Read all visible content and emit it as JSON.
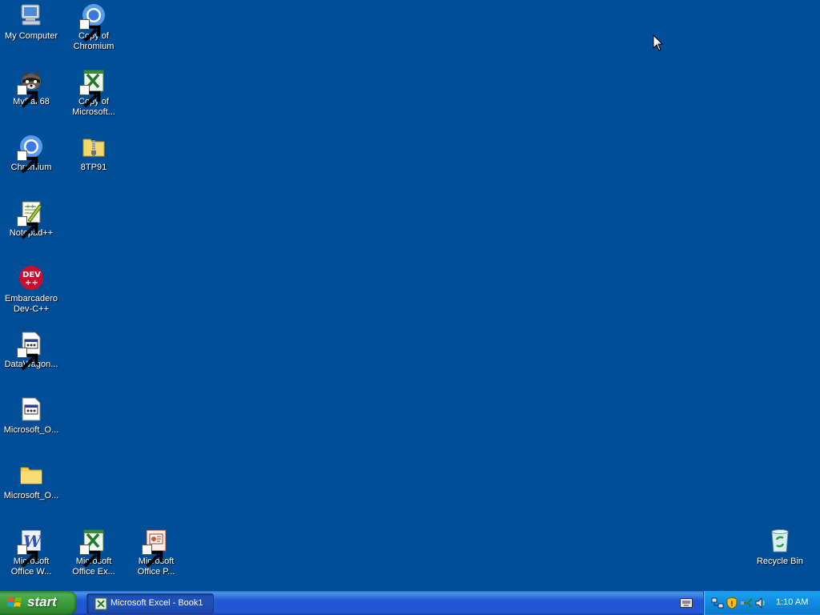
{
  "desktop": {
    "icons": {
      "my_computer": "My Computer",
      "copy_of_chromium": "Copy of Chromium",
      "mypal": "MyPal 68",
      "copy_of_excel": "Copy of Microsoft...",
      "chromium": "Chromium",
      "8tp91": "8TP91",
      "notepadpp": "Notepad++",
      "devcpp": "Embarcadero Dev-C++",
      "datawagon": "DataWagon...",
      "microsoft_o_file": "Microsoft_O...",
      "microsoft_o_folder": "Microsoft_O...",
      "office_word": "Microsoft Office W...",
      "office_excel": "Microsoft Office Ex...",
      "office_powerpoint": "Microsoft Office P...",
      "recycle_bin": "Recycle Bin"
    }
  },
  "taskbar": {
    "start_label": "start",
    "task_excel_label": "Microsoft Excel - Book1",
    "clock": "1:10 AM"
  },
  "colors": {
    "desktop_bg": "#004e98",
    "taskbar": "#2157d7",
    "start_green": "#379837",
    "tray": "#0f8ae0"
  }
}
